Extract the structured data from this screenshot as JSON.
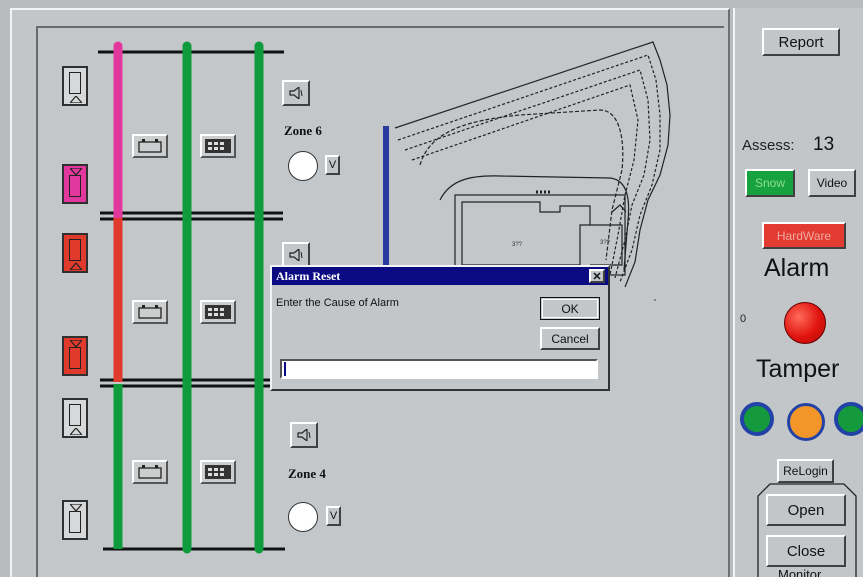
{
  "zones": {
    "zone_6": {
      "label": "Zone 6",
      "v_label": "V"
    },
    "zone_4": {
      "label": "Zone 4",
      "v_label": "V"
    }
  },
  "right_panel": {
    "report_label": "Report",
    "assess_label": "Assess:",
    "assess_value": "13",
    "snow_label": "Snow",
    "video_label": "Video",
    "hardware_label": "HardWare",
    "alarm_label": "Alarm",
    "alarm_count": "0",
    "tamper_label": "Tamper",
    "relogin_label": "ReLogin",
    "open_label": "Open",
    "close_label": "Close",
    "monitor_label": "Monitor"
  },
  "dialog": {
    "title": "Alarm Reset",
    "prompt": "Enter the Cause of Alarm",
    "ok_label": "OK",
    "cancel_label": "Cancel",
    "close_glyph": "✕",
    "input_value": ""
  },
  "map": {
    "room_a": "3??",
    "room_b": "3??"
  },
  "colors": {
    "pink": "#e2389e",
    "red": "#e03a2c",
    "green": "#0e9b3c",
    "blue": "#2a3aa0",
    "orange": "#f2962a",
    "snow_bg": "#17a23f",
    "hardware_bg": "#e23b31",
    "title_bar": "#0a0a82"
  },
  "icons": {
    "sensor": "door-sensor-icon",
    "battery": "battery-icon",
    "panel": "control-panel-icon",
    "speaker": "speaker-icon"
  }
}
